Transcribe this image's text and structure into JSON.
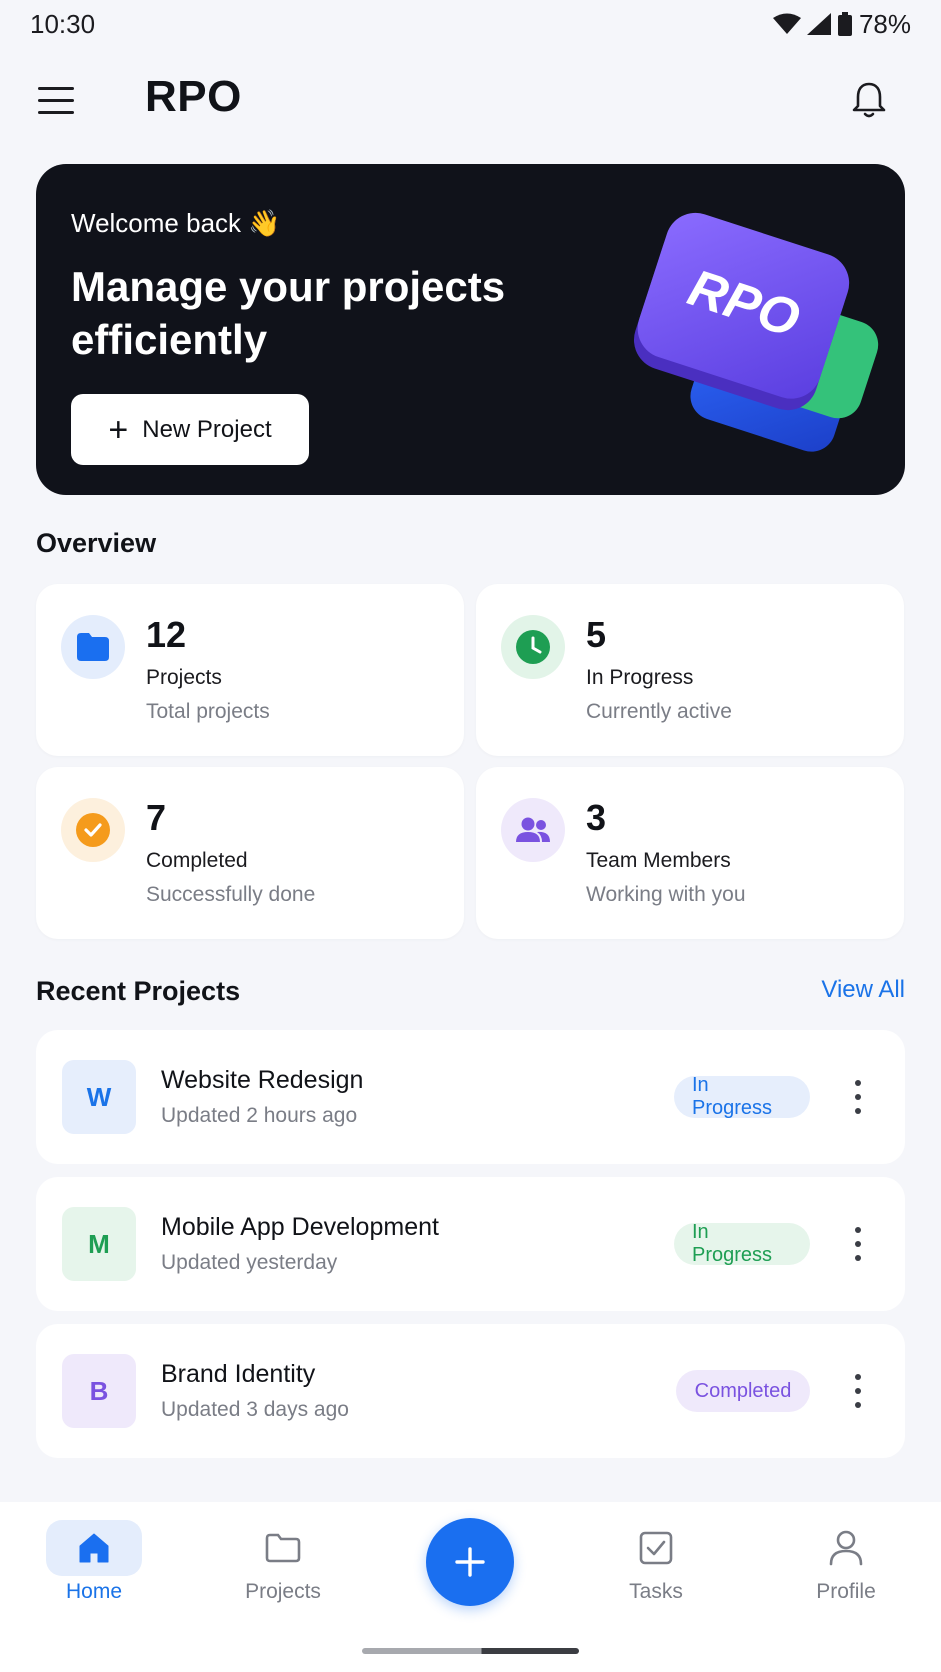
{
  "status_bar": {
    "time": "10:30",
    "battery": "78%"
  },
  "app_bar": {
    "title": "RPO"
  },
  "hero": {
    "welcome": "Welcome back 👋",
    "title": "Manage your projects efficiently",
    "button_label": "New Project",
    "logo_text": "RPO"
  },
  "overview": {
    "title": "Overview",
    "stats": [
      {
        "value": "12",
        "label": "Projects",
        "sub": "Total projects",
        "icon": "folder-icon",
        "color": "#1a6ff0",
        "bg": "#e4edfc"
      },
      {
        "value": "5",
        "label": "In Progress",
        "sub": "Currently active",
        "icon": "clock-icon",
        "color": "#1e9e53",
        "bg": "#e2f4e8"
      },
      {
        "value": "7",
        "label": "Completed",
        "sub": "Successfully done",
        "icon": "check-circle-icon",
        "color": "#f59b1c",
        "bg": "#fdf0dd"
      },
      {
        "value": "3",
        "label": "Team Members",
        "sub": "Working with you",
        "icon": "team-icon",
        "color": "#7a52e0",
        "bg": "#efe9fb"
      }
    ]
  },
  "recent": {
    "title": "Recent Projects",
    "view_all": "View All",
    "projects": [
      {
        "initial": "W",
        "name": "Website Redesign",
        "updated": "Updated 2 hours ago",
        "status": "In Progress",
        "status_color": "#1a73e8",
        "status_bg": "#e6eefc",
        "avatar_color": "#1a73e8",
        "avatar_bg": "#e6eefc"
      },
      {
        "initial": "M",
        "name": "Mobile App Development",
        "updated": "Updated yesterday",
        "status": "In Progress",
        "status_color": "#1e9e53",
        "status_bg": "#e6f5eb",
        "avatar_color": "#1e9e53",
        "avatar_bg": "#e6f5eb"
      },
      {
        "initial": "B",
        "name": "Brand Identity",
        "updated": "Updated 3 days ago",
        "status": "Completed",
        "status_color": "#7a52e0",
        "status_bg": "#efe9fb",
        "avatar_color": "#7a52e0",
        "avatar_bg": "#efe9fb"
      }
    ]
  },
  "bottom_nav": {
    "items": [
      {
        "label": "Home",
        "icon": "home-icon",
        "active": true
      },
      {
        "label": "Projects",
        "icon": "folder-outline-icon",
        "active": false
      },
      {
        "label": "Tasks",
        "icon": "task-check-icon",
        "active": false
      },
      {
        "label": "Profile",
        "icon": "person-icon",
        "active": false
      }
    ],
    "fab_icon": "plus-icon"
  }
}
